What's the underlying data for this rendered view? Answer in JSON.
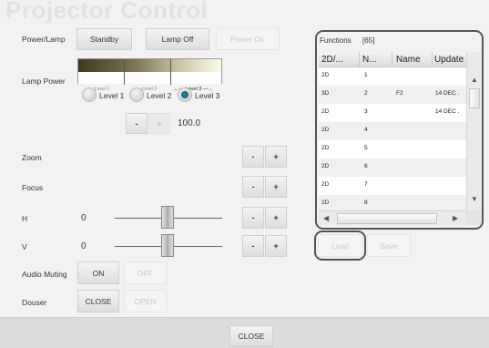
{
  "title": "Projector Control",
  "power": {
    "label": "Power/Lamp",
    "standby": "Standby",
    "lamp_off": "Lamp Off",
    "power_on": "Power On"
  },
  "lamp_power": {
    "label": "Lamp Power",
    "scale_labels": [
      "Level 1",
      "Level 2",
      "Level 3"
    ],
    "levels": [
      "Level 1",
      "Level 2",
      "Level 3"
    ],
    "selected": "Level 3",
    "minus": "-",
    "plus": "+",
    "value": "100.0"
  },
  "zoom": {
    "label": "Zoom",
    "minus": "-",
    "plus": "+"
  },
  "focus": {
    "label": "Focus",
    "minus": "-",
    "plus": "+"
  },
  "h": {
    "label": "H",
    "value": "0",
    "minus": "-",
    "plus": "+"
  },
  "v": {
    "label": "V",
    "value": "0",
    "minus": "-",
    "plus": "+"
  },
  "audio_muting": {
    "label": "Audio Muting",
    "on": "ON",
    "off": "OFF"
  },
  "douser": {
    "label": "Douser",
    "close": "CLOSE",
    "open": "OPEN"
  },
  "functions": {
    "label": "Functions",
    "count": "[65]",
    "columns": [
      "2D/...",
      "N...",
      "Name",
      "Update"
    ],
    "rows": [
      [
        "2D",
        "1",
        "",
        ""
      ],
      [
        "3D",
        "2",
        "F2",
        "14 DEC ."
      ],
      [
        "2D",
        "3",
        "",
        "14 DEC ."
      ],
      [
        "2D",
        "4",
        "",
        ""
      ],
      [
        "2D",
        "5",
        "",
        ""
      ],
      [
        "2D",
        "6",
        "",
        ""
      ],
      [
        "2D",
        "7",
        "",
        ""
      ],
      [
        "2D",
        "8",
        "",
        ""
      ]
    ],
    "load": "Load",
    "save": "Save"
  },
  "footer": {
    "close": "CLOSE"
  },
  "colors": {
    "radio_selected": "#1a7f9a",
    "panel_ring": "#555555"
  }
}
